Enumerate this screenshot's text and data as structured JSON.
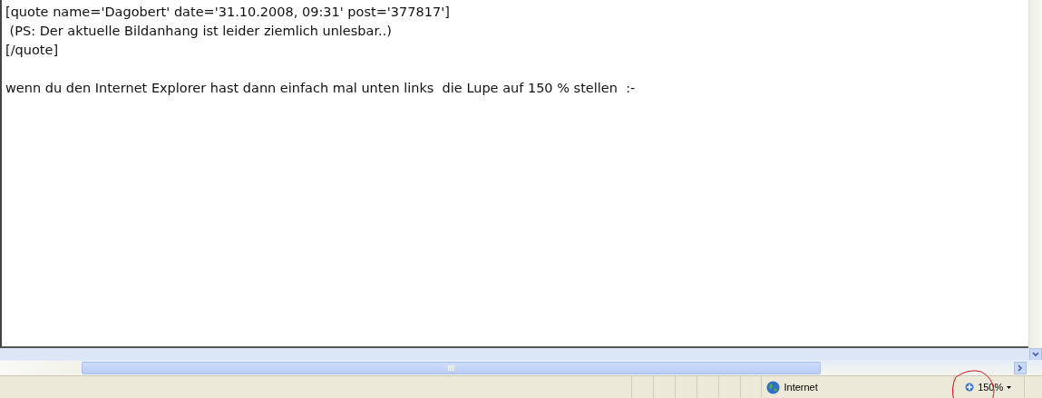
{
  "editor": {
    "quote_lines": [
      "[quote name='Dagobert' date='31.10.2008, 09:31' post='377817']",
      " (PS: Der aktuelle Bildanhang ist leider ziemlich unlesbar..)",
      "[/quote]"
    ],
    "reply": "wenn du den Internet Explorer hast dann einfach mal unten links  die Lupe auf 150 % stellen  :-"
  },
  "status_bar": {
    "zone": "Internet",
    "zoom": "150%"
  }
}
